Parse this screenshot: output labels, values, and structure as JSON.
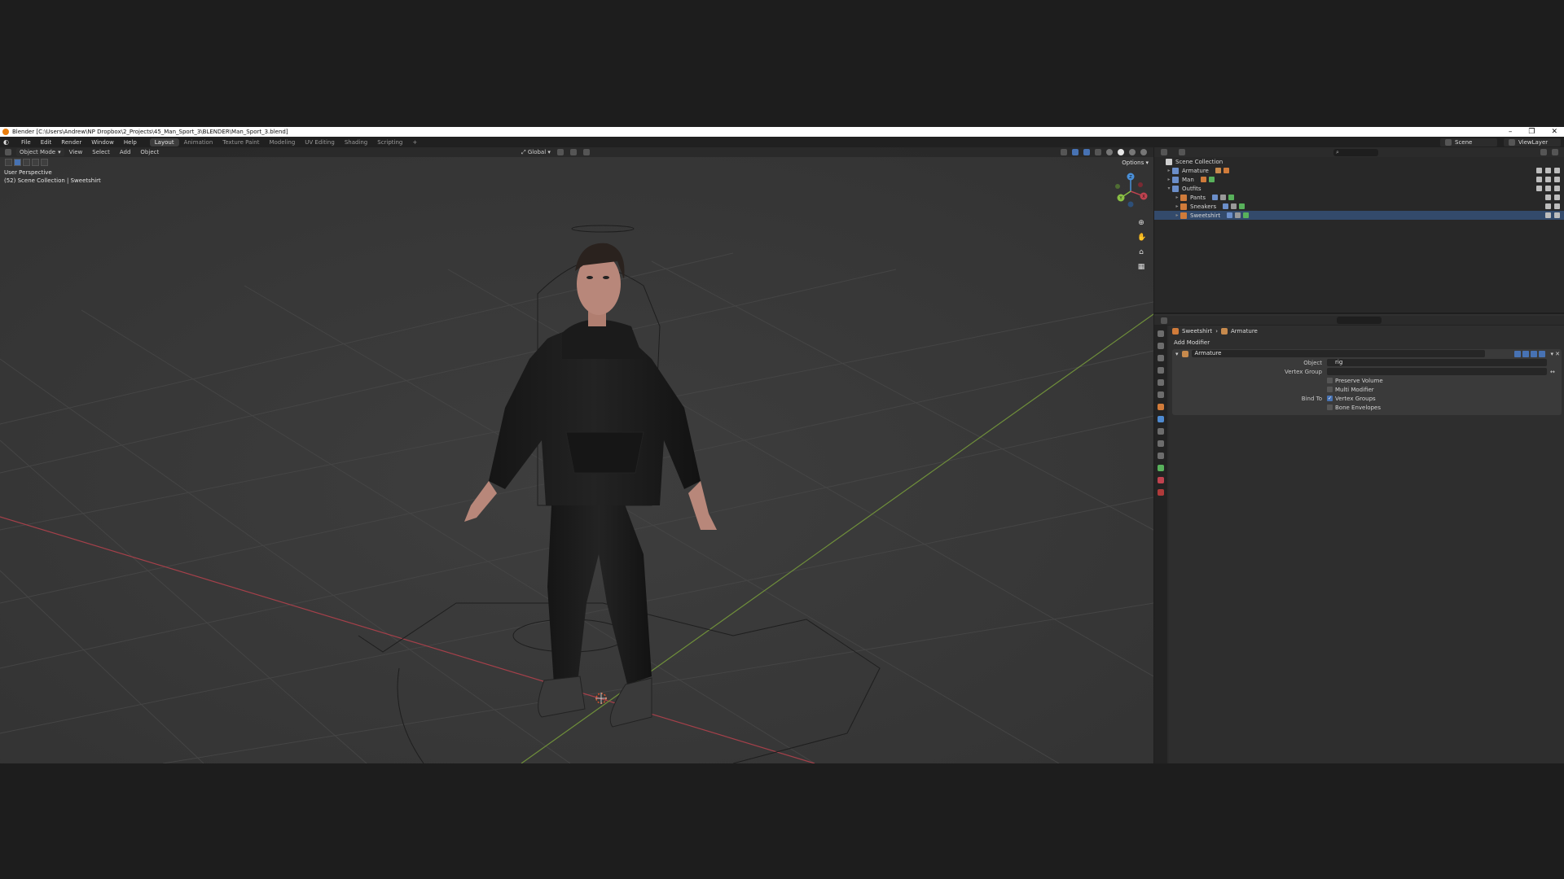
{
  "titlebar": {
    "title": "Blender [C:\\Users\\Andrew\\NP Dropbox\\2_Projects\\45_Man_Sport_3\\BLENDER\\Man_Sport_3.blend]",
    "minimize": "–",
    "restore": "❐",
    "close": "✕"
  },
  "menubar": {
    "menus": [
      "File",
      "Edit",
      "Render",
      "Window",
      "Help"
    ],
    "workspaces": [
      "Layout",
      "Animation",
      "Texture Paint",
      "Modeling",
      "UV Editing",
      "Shading",
      "Scripting"
    ],
    "add_workspace": "+",
    "active_workspace": "Layout",
    "scene": "Scene",
    "view_layer": "ViewLayer"
  },
  "viewport": {
    "mode": "Object Mode",
    "menus": [
      "View",
      "Select",
      "Add",
      "Object"
    ],
    "orientation": "Global",
    "perspective_label": "User Perspective",
    "collection_label": "(52) Scene Collection | Sweetshirt",
    "options": "Options",
    "gizmo_axes": {
      "x": "X",
      "y": "Y",
      "z": "Z"
    },
    "colors": {
      "x_axis": "#c0424f",
      "y_axis": "#8ac044",
      "z_axis": "#4a90d9",
      "grid": "#444444",
      "background": "#393939"
    }
  },
  "outliner": {
    "search_placeholder": "⌕",
    "root": "Scene Collection",
    "items": [
      {
        "name": "Armature",
        "level": 1
      },
      {
        "name": "Man",
        "level": 1
      },
      {
        "name": "Outfits",
        "level": 1
      },
      {
        "name": "Pants",
        "level": 2
      },
      {
        "name": "Sneakers",
        "level": 2
      },
      {
        "name": "Sweetshirt",
        "level": 2
      }
    ]
  },
  "properties": {
    "breadcrumb_object": "Sweetshirt",
    "breadcrumb_sep": "›",
    "breadcrumb_modifier": "Armature",
    "add_modifier": "Add Modifier",
    "modifier": {
      "name": "Armature",
      "object_label": "Object",
      "object_value": "rig",
      "vertex_group_label": "Vertex Group",
      "vertex_group_value": "",
      "preserve_volume": "Preserve Volume",
      "multi_modifier": "Multi Modifier",
      "bind_to_label": "Bind To",
      "vertex_groups": "Vertex Groups",
      "vertex_groups_checked": true,
      "bone_envelopes": "Bone Envelopes",
      "bone_envelopes_checked": false
    }
  }
}
